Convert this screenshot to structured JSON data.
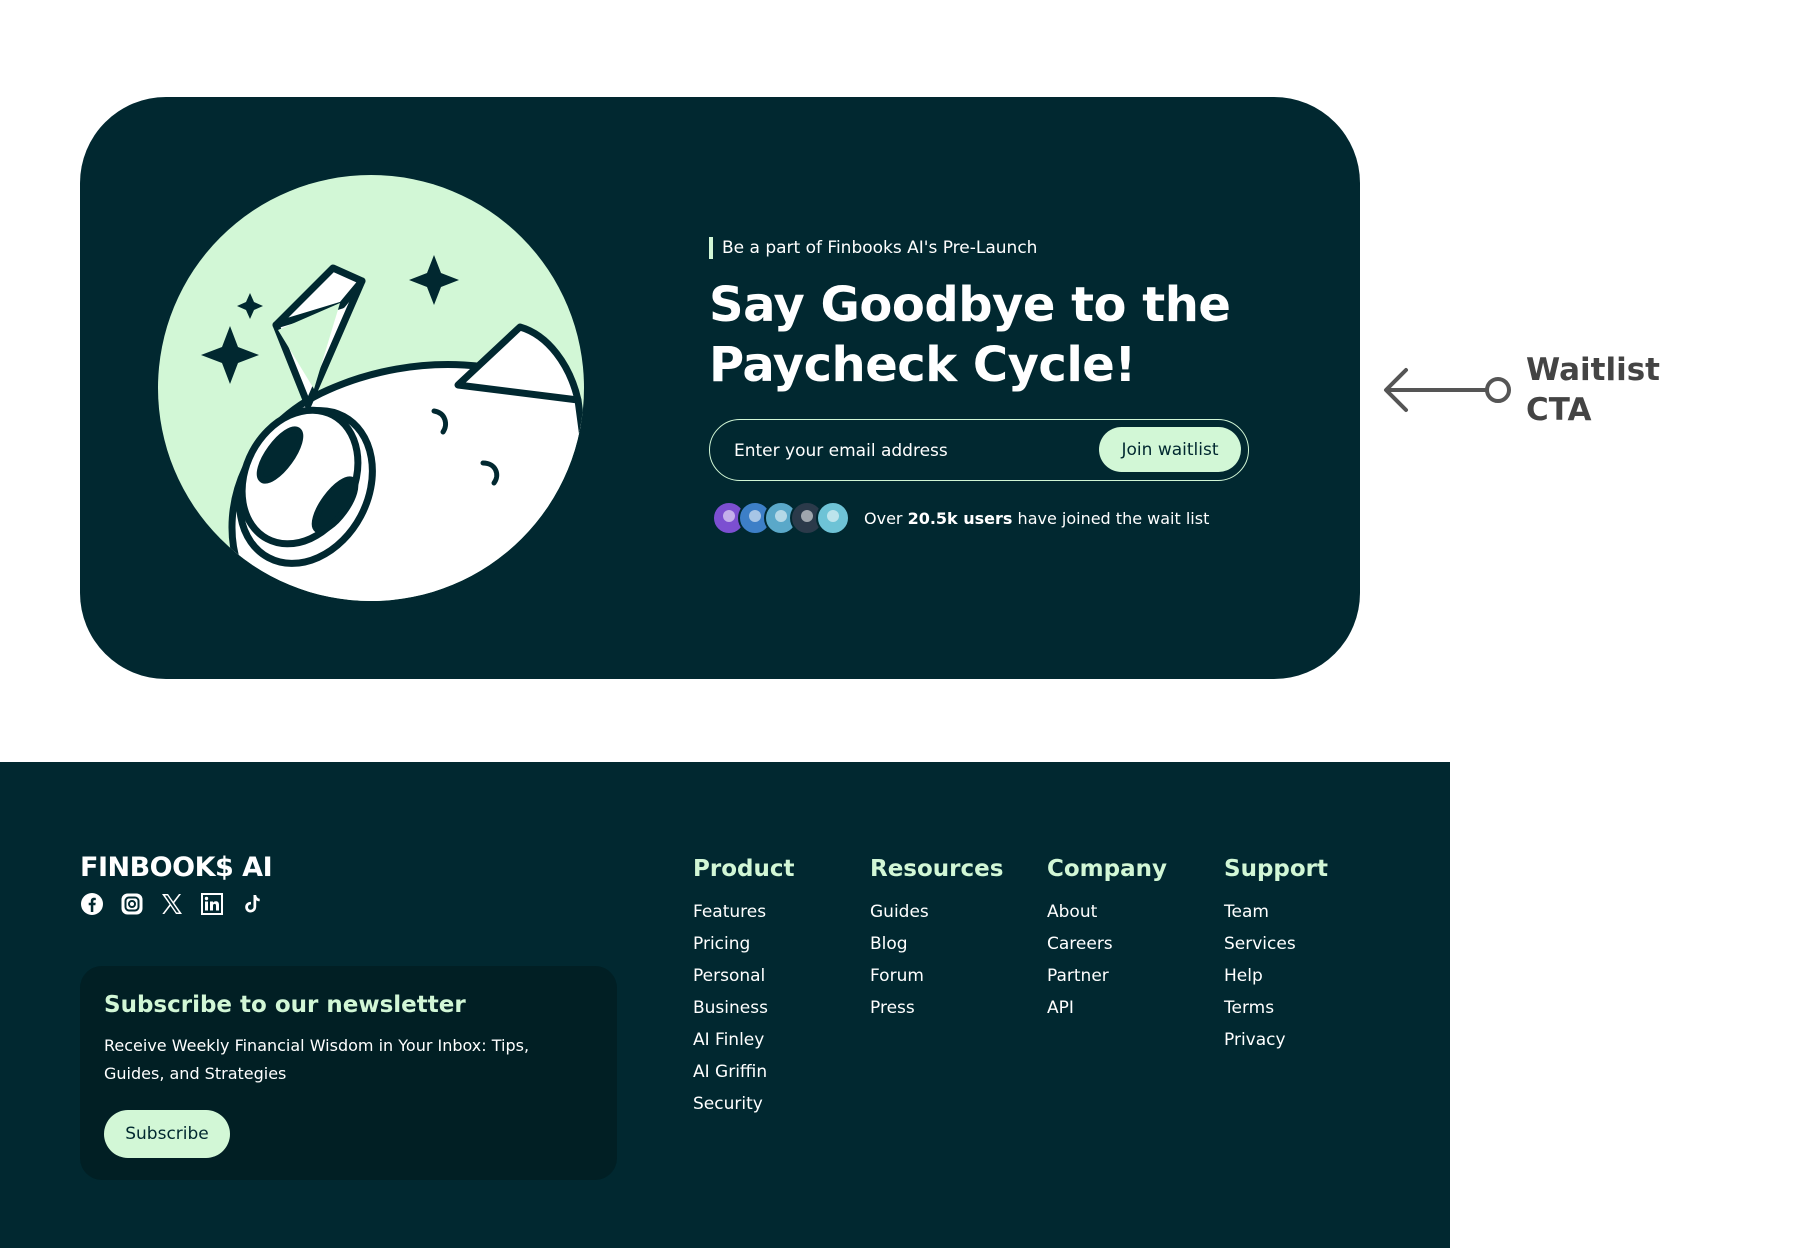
{
  "cta": {
    "eyebrow": "Be a part of Finbooks AI's Pre-Launch",
    "headline": "Say Goodbye to the Paycheck Cycle!",
    "email_placeholder": "Enter your email address",
    "join_label": "Join waitlist",
    "proof_prefix": "Over",
    "proof_count": "20.5k users",
    "proof_suffix": "have joined the wait list",
    "avatars": [
      "avatar-1",
      "avatar-2",
      "avatar-3",
      "avatar-4",
      "avatar-5"
    ]
  },
  "annotation": {
    "label": "Waitlist CTA"
  },
  "footer": {
    "logo": "FINBOOK$ AI",
    "socials": [
      "facebook-icon",
      "instagram-icon",
      "x-icon",
      "linkedin-icon",
      "tiktok-icon"
    ],
    "newsletter": {
      "title": "Subscribe to our newsletter",
      "description": "Receive Weekly Financial Wisdom in Your Inbox: Tips, Guides, and Strategies",
      "button": "Subscribe"
    },
    "columns": [
      {
        "title": "Product",
        "links": [
          "Features",
          "Pricing",
          "Personal",
          "Business",
          "AI Finley",
          "AI Griffin",
          "Security"
        ]
      },
      {
        "title": "Resources",
        "links": [
          "Guides",
          "Blog",
          "Forum",
          "Press"
        ]
      },
      {
        "title": "Company",
        "links": [
          "About",
          "Careers",
          "Partner",
          "API"
        ]
      },
      {
        "title": "Support",
        "links": [
          "Team",
          "Services",
          "Help",
          "Terms",
          "Privacy"
        ]
      }
    ]
  },
  "colors": {
    "dark_teal": "#012830",
    "mint": "#d2f7d6",
    "newsletter_bg": "#011f24",
    "annotation_gray": "#444444"
  }
}
